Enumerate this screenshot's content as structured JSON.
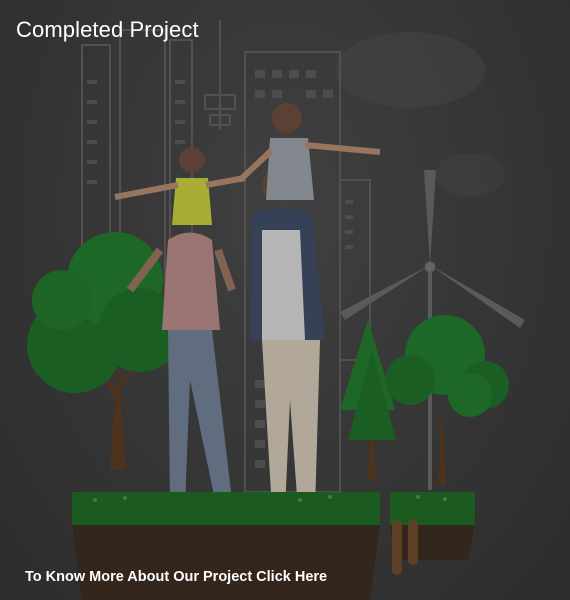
{
  "card": {
    "title": "Completed Project",
    "cta_label": "To Know More About Our Project Click Here"
  },
  "image": {
    "subject": "family-with-city-and-trees-illustration"
  },
  "colors": {
    "background": "#3b3b3b",
    "text": "#ffffff",
    "tree_green": "#1f7a2a",
    "grass_green": "#1d6b21",
    "trunk": "#5a3a1e"
  }
}
